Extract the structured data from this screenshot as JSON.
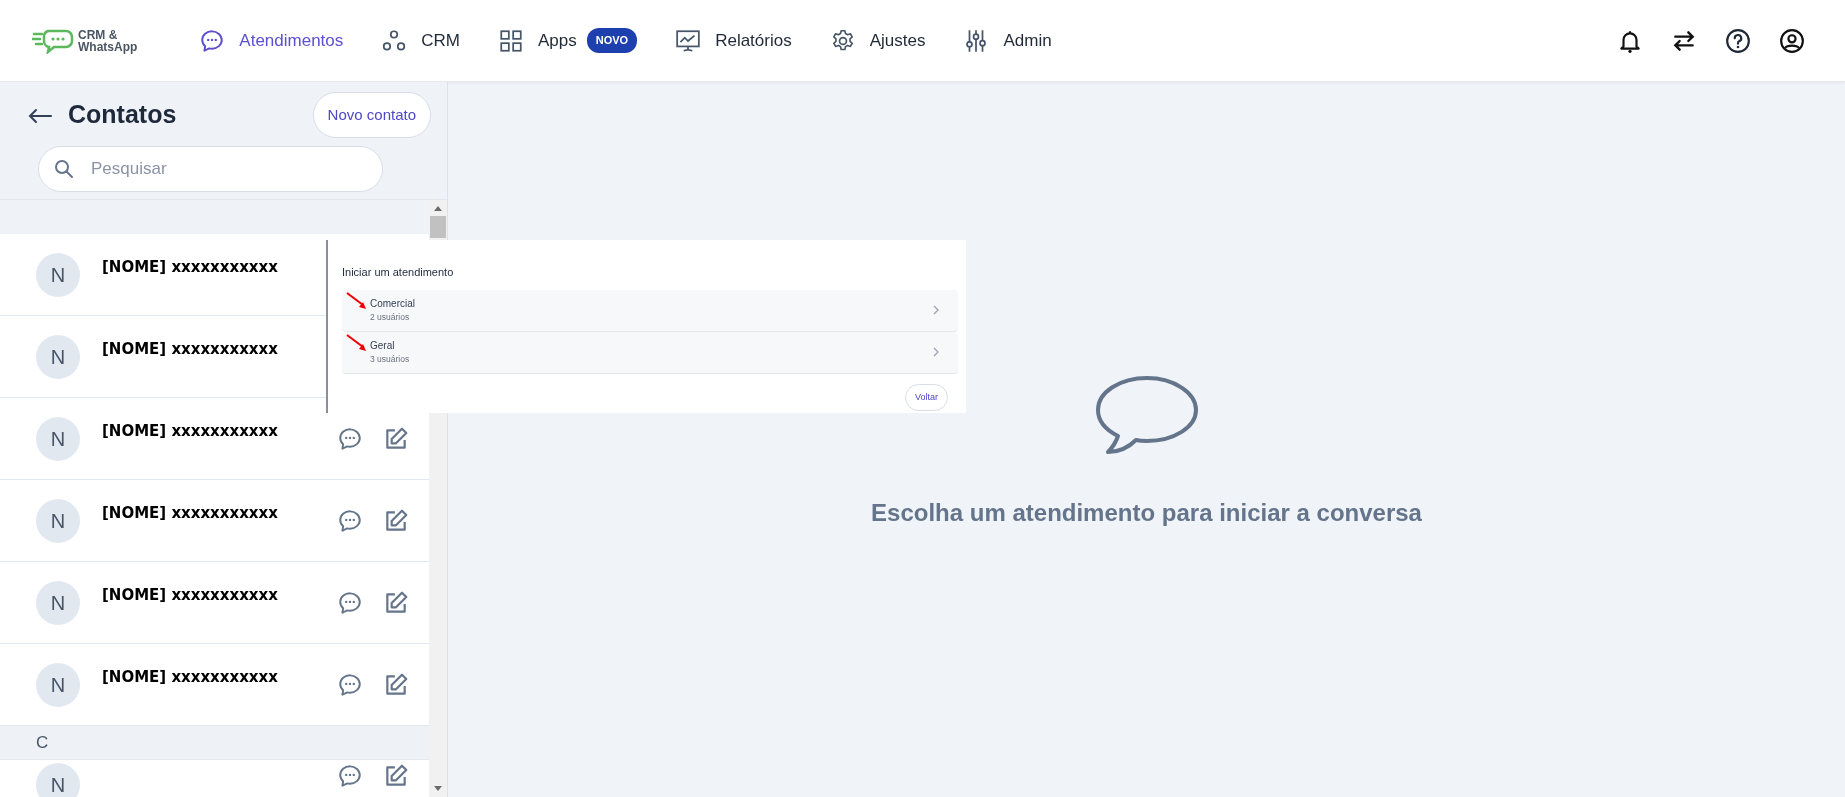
{
  "logo": {
    "line_1": "CRM &",
    "line_2": "WhatsApp"
  },
  "nav": [
    {
      "label": "Atendimentos",
      "selected": true
    },
    {
      "label": "CRM",
      "selected": false
    },
    {
      "label": "Apps",
      "selected": false,
      "badge": "NOVO"
    },
    {
      "label": "Relatórios",
      "selected": false
    },
    {
      "label": "Ajustes",
      "selected": false
    },
    {
      "label": "Admin",
      "selected": false
    }
  ],
  "contacts_panel": {
    "title": "Contatos",
    "new_button": "Novo contato",
    "search": {
      "placeholder": "Pesquisar"
    },
    "items": [
      {
        "kind": "contact",
        "initial": "N",
        "name": "[NOME] xxxxxxxxxxx",
        "actions_visible": false
      },
      {
        "kind": "contact",
        "initial": "N",
        "name": "[NOME] xxxxxxxxxxx",
        "actions_visible": false
      },
      {
        "kind": "contact",
        "initial": "N",
        "name": "[NOME] xxxxxxxxxxx",
        "actions_visible": true
      },
      {
        "kind": "contact",
        "initial": "N",
        "name": "[NOME] xxxxxxxxxxx",
        "actions_visible": true
      },
      {
        "kind": "contact",
        "initial": "N",
        "name": "[NOME] xxxxxxxxxxx",
        "actions_visible": true
      },
      {
        "kind": "contact",
        "initial": "N",
        "name": "[NOME] xxxxxxxxxxx",
        "actions_visible": true
      },
      {
        "kind": "section",
        "label": "C"
      },
      {
        "kind": "contact",
        "initial": "N",
        "actions_visible": true
      }
    ]
  },
  "start_dialog": {
    "title": "Iniciar um atendimento",
    "queues": [
      {
        "name": "Comercial",
        "users": "2 usuários",
        "annotated": true
      },
      {
        "name": "Geral",
        "users": "3 usuários",
        "annotated": true
      }
    ],
    "back_button": "Voltar"
  },
  "empty_state": {
    "message": "Escolha um atendimento para iniciar a conversa"
  }
}
